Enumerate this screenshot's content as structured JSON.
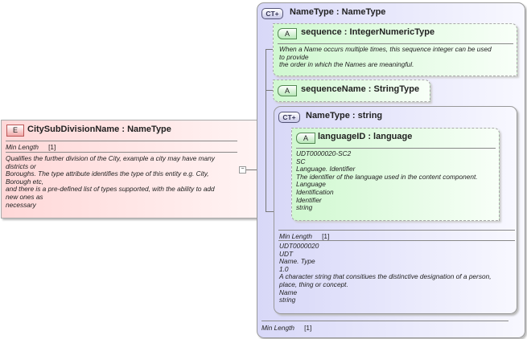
{
  "element": {
    "badge": "E",
    "title": "CitySubDivisionName : NameType",
    "min_length_label": "Min Length",
    "min_length_value": "[1]",
    "doc": [
      "Qualifies the further division of the City, example a city may have many",
      "districts or",
      "Boroughs. The type attribute identifies the type of this entity e.g. City,",
      "Borough etc,",
      "and there is a pre-defined list of types supported, with the ability to add",
      "new ones as",
      "necessary"
    ]
  },
  "complex_type": {
    "badge": "CT+",
    "title": "NameType : NameType",
    "min_length_label": "Min Length",
    "min_length_value": "[1]",
    "sequence": {
      "badge": "A",
      "title": "sequence : IntegerNumericType",
      "doc": [
        "When a Name occurs multiple times, this sequence integer can be used",
        "to provide",
        "the order in which the Names are meaningful."
      ]
    },
    "sequence_name": {
      "badge": "A",
      "title": "sequenceName : StringType"
    },
    "inner": {
      "badge": "CT+",
      "title": "NameType : string",
      "min_length_label": "Min Length",
      "min_length_value": "[1]",
      "doc": [
        "UDT0000020",
        "UDT",
        "Name. Type",
        "1.0",
        "A character string that consitiues the distinctive designation of a person,",
        "place, thing or concept.",
        "Name",
        "string"
      ],
      "language_id": {
        "badge": "A",
        "title": "languageID : language",
        "doc": [
          "UDT0000020-SC2",
          "SC",
          "Language. Identifier",
          "The identifier of the language used in the content component.",
          "Language",
          "Identification",
          "Identifier",
          "string"
        ]
      }
    }
  }
}
